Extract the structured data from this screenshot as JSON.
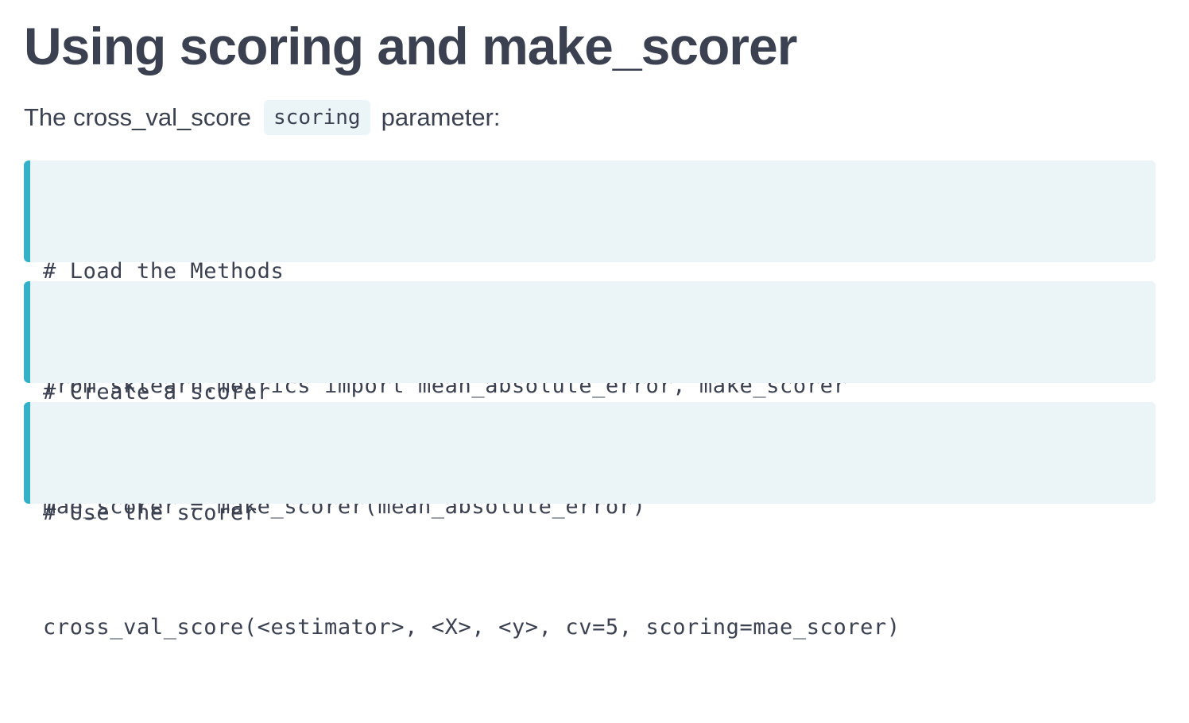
{
  "heading": "Using scoring and make_scorer",
  "intro": {
    "before": "The cross_val_score",
    "code": "scoring",
    "after": "parameter:"
  },
  "code_blocks": [
    {
      "comment": "# Load the Methods",
      "code": "from sklearn.metrics import mean_absolute_error, make_scorer"
    },
    {
      "comment": "# Create a scorer",
      "code": "mae_scorer = make_scorer(mean_absolute_error)"
    },
    {
      "comment": "# Use the scorer",
      "code": "cross_val_score(<estimator>, <X>, <y>, cv=5, scoring=mae_scorer)"
    }
  ],
  "colors": {
    "text": "#3b4150",
    "code_background": "#ebf4f7",
    "accent_bar": "#35b0c9"
  }
}
